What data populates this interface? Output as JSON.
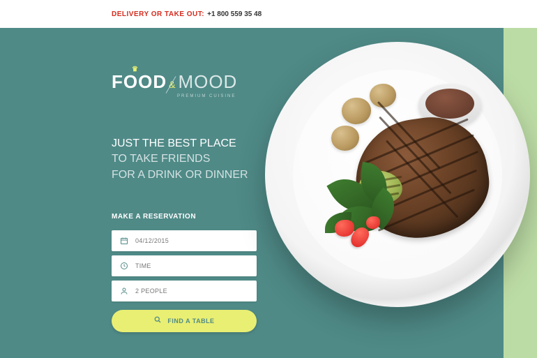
{
  "topbar": {
    "label": "DELIVERY OR TAKE OUT:",
    "phone": "+1 800 559 35 48"
  },
  "logo": {
    "food": "FOOD",
    "amp": "&",
    "mood": "MOOD",
    "sub": "PREMIUM CUISINE"
  },
  "headline": {
    "line1": "JUST THE BEST PLACE",
    "line2": "TO TAKE FRIENDS",
    "line3": "FOR A DRINK OR DINNER"
  },
  "form": {
    "heading": "MAKE A RESERVATION",
    "date": "04/12/2015",
    "time": "TIME",
    "people": "2 PEOPLE",
    "cta": "FIND A TABLE"
  },
  "colors": {
    "accent": "#e9ef72",
    "teal": "#4f8a87",
    "danger": "#d52b1e"
  }
}
